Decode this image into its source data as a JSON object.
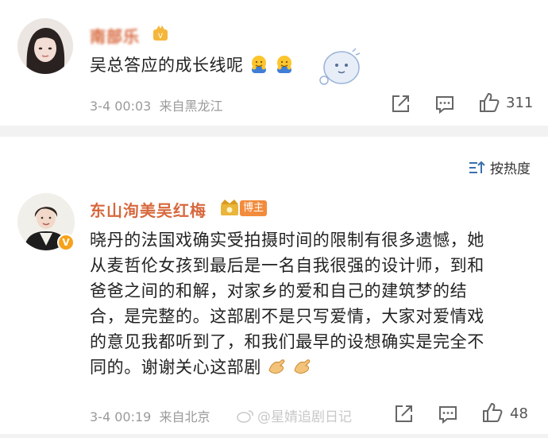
{
  "comment1": {
    "username": "南部乐",
    "text": "吴总答应的成长线呢",
    "time": "3-4 00:03",
    "location": "来自黑龙江",
    "like_count": "311"
  },
  "sort": {
    "label": "按热度"
  },
  "comment2": {
    "username": "东山洵美吴红梅",
    "role_badge": "博主",
    "verified_badge": "V",
    "text_lines": [
      "晓丹的法国戏确实受拍摄时间的限制有很多遗憾，她",
      "从麦哲伦女孩到最后是一名自我很强的设计师，到和",
      "爸爸之间的和解，对家乡的爱和自己的建筑梦的结",
      "合，是完整的。这部剧不是只写爱情，大家对爱情戏",
      "的意见我都听到了，和我们最早的设想确实是完全不",
      "同的。谢谢关心这部剧"
    ],
    "time": "3-4 00:19",
    "location": "来自北京",
    "like_count": "48"
  },
  "watermark": {
    "text": "@星婧追剧日记"
  },
  "colors": {
    "username": "#d7683d",
    "meta": "#9a9a9a",
    "badge": "#f28b3c",
    "verified": "#f7a21b"
  },
  "icons": [
    "share-icon",
    "comment-icon",
    "like-icon",
    "sort-icon",
    "crown-icon",
    "hug-emoji",
    "clap-emoji",
    "sticker"
  ]
}
